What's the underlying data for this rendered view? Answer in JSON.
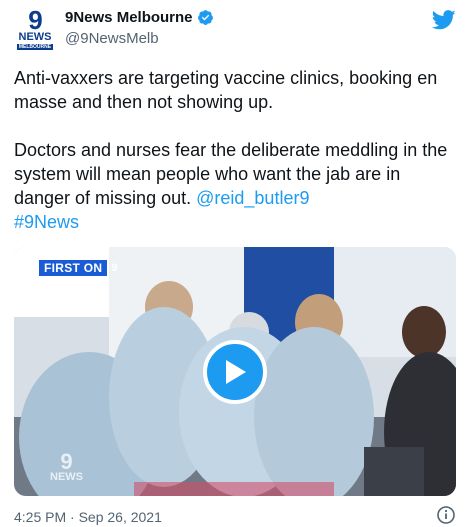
{
  "account": {
    "display_name": "9News Melbourne",
    "handle": "@9NewsMelb",
    "avatar_text": {
      "nine": "9",
      "news": "NEWS",
      "region": "MELBOURNE"
    }
  },
  "tweet": {
    "paragraph1": "Anti-vaxxers are targeting vaccine clinics, booking en masse and then not showing up.",
    "paragraph2_text": "Doctors and nurses fear the deliberate meddling in the system will mean people who want the jab are in danger of missing out.",
    "mention": "@reid_butler9",
    "hashtag": "#9News"
  },
  "media": {
    "badge_text": "FIRST ON",
    "badge_logo": "9",
    "watermark_nine": "9",
    "watermark_news": "NEWS"
  },
  "timestamp": "4:25 PM · Sep 26, 2021",
  "colors": {
    "link": "#1d9bf0",
    "verified": "#1d9bf0",
    "twitter_blue": "#1d9bf0",
    "secondary_text": "#536471"
  },
  "icons": {
    "verified": "verified-badge-icon",
    "twitter": "twitter-bird-icon",
    "play": "play-icon",
    "info": "info-icon"
  }
}
